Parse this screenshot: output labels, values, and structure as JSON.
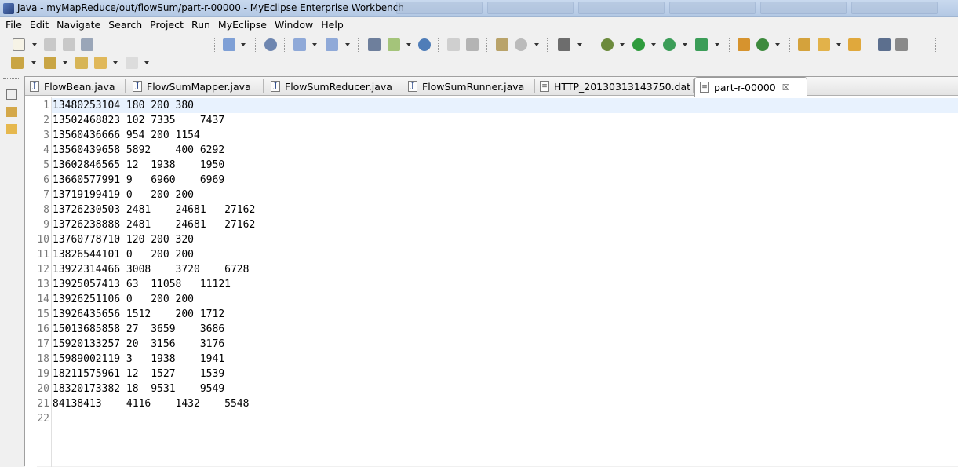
{
  "window": {
    "title": "Java - myMapReduce/out/flowSum/part-r-00000 - MyEclipse Enterprise Workbench"
  },
  "menu": [
    "File",
    "Edit",
    "Navigate",
    "Search",
    "Project",
    "Run",
    "MyEclipse",
    "Window",
    "Help"
  ],
  "tabs": [
    {
      "label": "FlowBean.java",
      "icon": "java-file-icon",
      "active": false
    },
    {
      "label": "FlowSumMapper.java",
      "icon": "java-file-icon",
      "active": false
    },
    {
      "label": "FlowSumReducer.java",
      "icon": "java-file-icon",
      "active": false
    },
    {
      "label": "FlowSumRunner.java",
      "icon": "java-file-icon",
      "active": false
    },
    {
      "label": "HTTP_20130313143750.dat",
      "icon": "text-file-icon",
      "active": false
    },
    {
      "label": "part-r-00000",
      "icon": "text-file-icon",
      "active": true,
      "close": "☒"
    }
  ],
  "editor": {
    "lines": [
      {
        "no": "1",
        "text": "13480253104 180 200 380"
      },
      {
        "no": "2",
        "text": "13502468823 102 7335    7437"
      },
      {
        "no": "3",
        "text": "13560436666 954 200 1154"
      },
      {
        "no": "4",
        "text": "13560439658 5892    400 6292"
      },
      {
        "no": "5",
        "text": "13602846565 12  1938    1950"
      },
      {
        "no": "6",
        "text": "13660577991 9   6960    6969"
      },
      {
        "no": "7",
        "text": "13719199419 0   200 200"
      },
      {
        "no": "8",
        "text": "13726230503 2481    24681   27162"
      },
      {
        "no": "9",
        "text": "13726238888 2481    24681   27162"
      },
      {
        "no": "10",
        "text": "13760778710 120 200 320"
      },
      {
        "no": "11",
        "text": "13826544101 0   200 200"
      },
      {
        "no": "12",
        "text": "13922314466 3008    3720    6728"
      },
      {
        "no": "13",
        "text": "13925057413 63  11058   11121"
      },
      {
        "no": "14",
        "text": "13926251106 0   200 200"
      },
      {
        "no": "15",
        "text": "13926435656 1512    200 1712"
      },
      {
        "no": "16",
        "text": "15013685858 27  3659    3686"
      },
      {
        "no": "17",
        "text": "15920133257 20  3156    3176"
      },
      {
        "no": "18",
        "text": "15989002119 3   1938    1941"
      },
      {
        "no": "19",
        "text": "18211575961 12  1527    1539"
      },
      {
        "no": "20",
        "text": "18320173382 18  9531    9549"
      },
      {
        "no": "21",
        "text": "84138413    4116    1432    5548"
      },
      {
        "no": "22",
        "text": ""
      }
    ]
  },
  "colors": {
    "current_line": "#e8f2fe",
    "line_number": "#787878"
  }
}
